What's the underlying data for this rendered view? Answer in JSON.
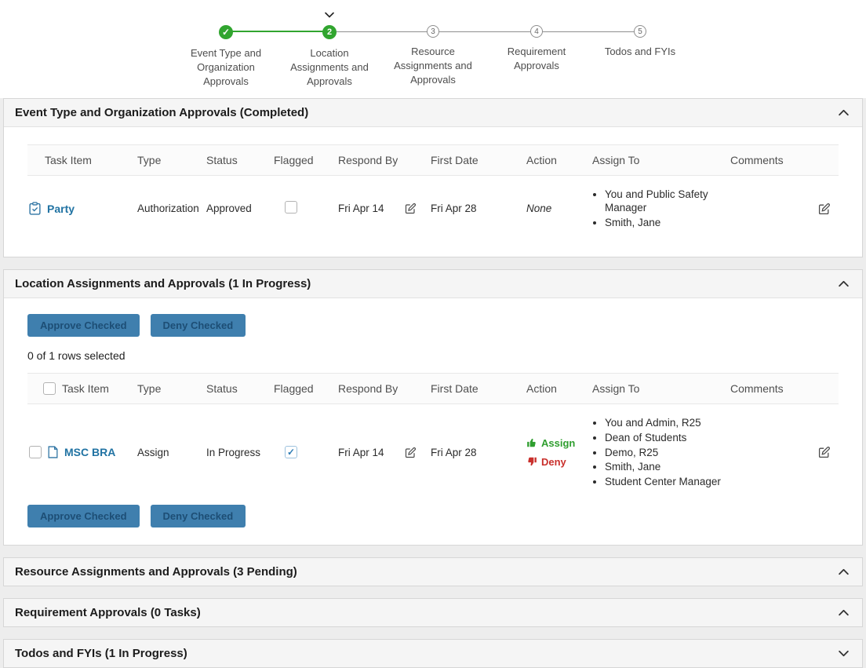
{
  "icons": {
    "check": "✓"
  },
  "colors": {
    "green": "#31a52f",
    "link": "#2173a3",
    "red": "#c9302c",
    "button": "#3f7fae"
  },
  "stepper": {
    "steps": [
      {
        "label": "Event Type and Organization Approvals",
        "number": "",
        "state": "completed"
      },
      {
        "label": "Location Assignments and Approvals",
        "number": "2",
        "state": "active"
      },
      {
        "label": "Resource Assignments and Approvals",
        "number": "3",
        "state": "upcoming"
      },
      {
        "label": "Requirement Approvals",
        "number": "4",
        "state": "upcoming"
      },
      {
        "label": "Todos and FYIs",
        "number": "5",
        "state": "upcoming"
      }
    ]
  },
  "columns": [
    "Task Item",
    "Type",
    "Status",
    "Flagged",
    "Respond By",
    "First Date",
    "Action",
    "Assign To",
    "Comments"
  ],
  "section1": {
    "title": "Event Type and Organization Approvals (Completed)",
    "row": {
      "task_item": "Party",
      "type": "Authorization",
      "status": "Approved",
      "flagged": false,
      "respond_by": "Fri Apr 14",
      "first_date": "Fri Apr 28",
      "action": "None",
      "assign_to": [
        "You and Public Safety Manager",
        "Smith, Jane"
      ]
    }
  },
  "section2": {
    "title": "Location Assignments and Approvals (1 In Progress)",
    "approve_button": "Approve Checked",
    "deny_button": "Deny Checked",
    "selection_text": "0 of 1 rows selected",
    "row": {
      "task_item": "MSC BRA",
      "type": "Assign",
      "status": "In Progress",
      "flagged": true,
      "respond_by": "Fri Apr 14",
      "first_date": "Fri Apr 28",
      "action_assign": "Assign",
      "action_deny": "Deny",
      "assign_to": [
        "You and Admin, R25",
        "Dean of Students",
        "Demo, R25",
        "Smith, Jane",
        "Student Center Manager"
      ]
    }
  },
  "section3": {
    "title": "Resource Assignments and Approvals (3 Pending)"
  },
  "section4": {
    "title": "Requirement Approvals (0 Tasks)"
  },
  "section5": {
    "title": "Todos and FYIs (1 In Progress)"
  }
}
